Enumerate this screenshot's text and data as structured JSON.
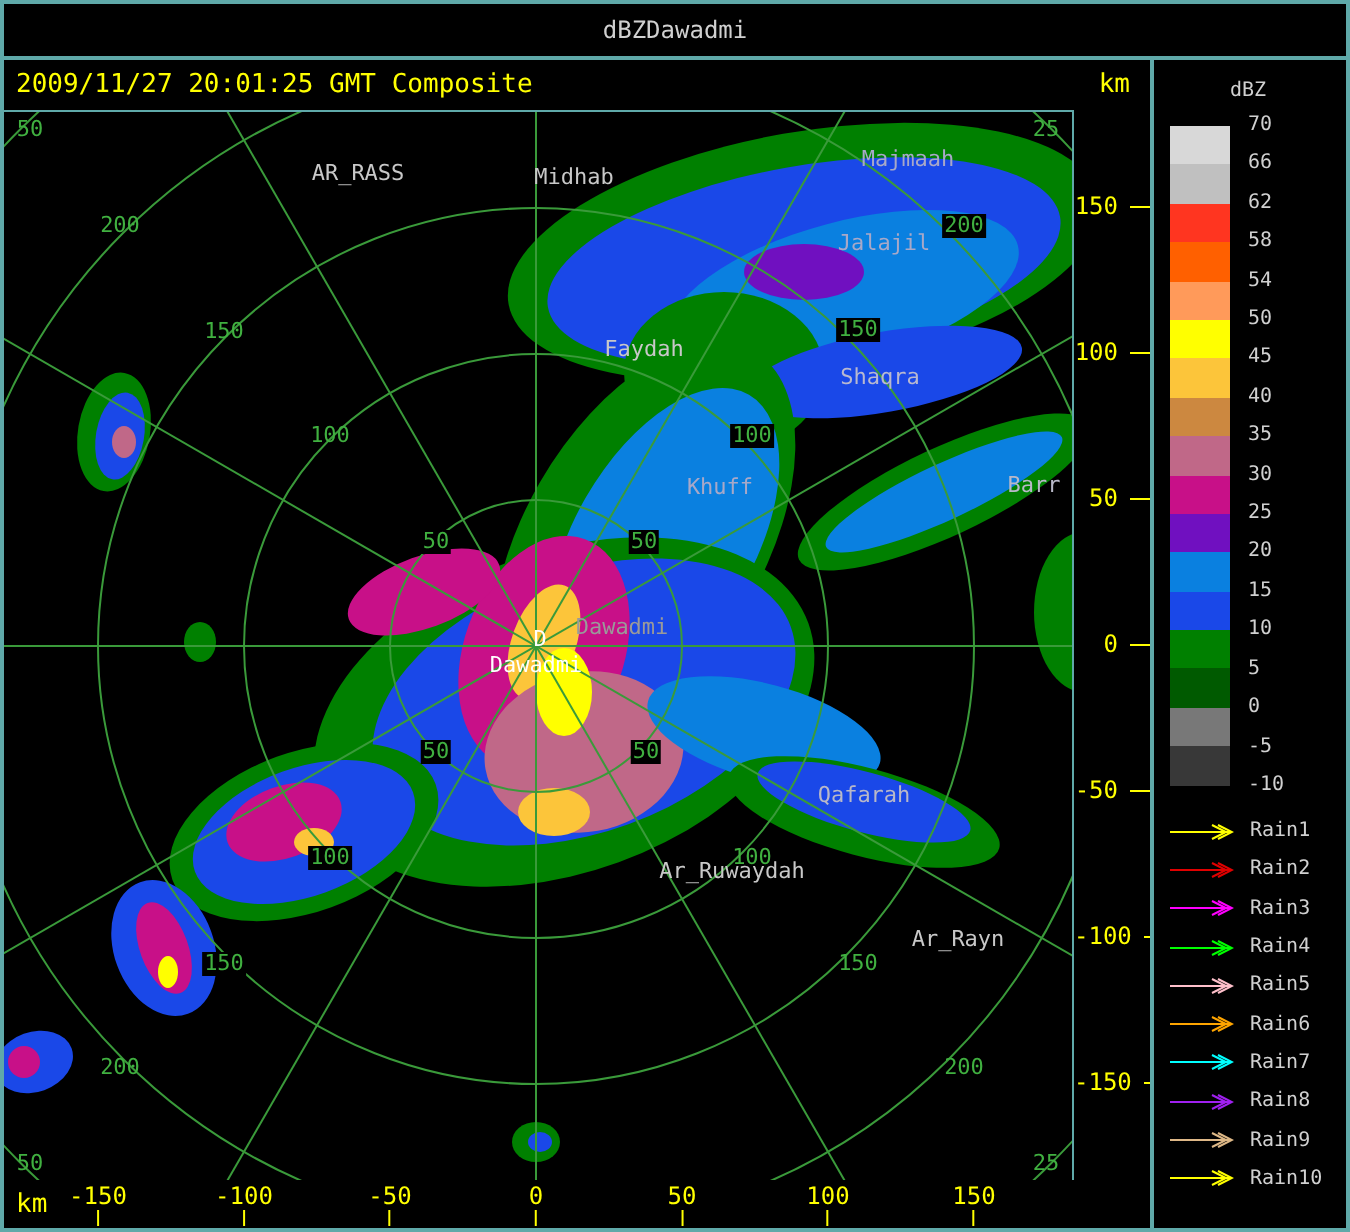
{
  "window": {
    "title": "dBZDawadmi"
  },
  "map": {
    "timestamp": "2009/11/27 20:01:25 GMT Composite",
    "unit": "km",
    "ring_labels": [
      "50",
      "25",
      "200",
      "150",
      "100",
      "50",
      "50",
      "100",
      "150",
      "200",
      "50",
      "100",
      "150",
      "200",
      "50",
      "100",
      "150",
      "200",
      "50",
      "25"
    ],
    "site": {
      "marker": "D",
      "name": "Dawadmi"
    },
    "places": [
      "AR_RASS",
      "Midhab",
      "Majmaah",
      "Jalajil",
      "Faydah",
      "Shaqra",
      "Khuff",
      "Barr",
      "Dawadmi",
      "Qafarah",
      "Ar_Ruwaydah",
      "Ar_Rayn"
    ],
    "y_axis": {
      "ticks": [
        "150",
        "100",
        "50",
        "0",
        "-50",
        "-100",
        "-150"
      ]
    },
    "x_axis": {
      "unit": "km",
      "ticks": [
        "-150",
        "-100",
        "-50",
        "0",
        "50",
        "100",
        "150"
      ]
    }
  },
  "legend": {
    "title": "dBZ",
    "bands": [
      {
        "color": "#d8d8d8"
      },
      {
        "color": "#c0c0c0"
      },
      {
        "color": "#ff3520"
      },
      {
        "color": "#ff6000"
      },
      {
        "color": "#ff9a5a"
      },
      {
        "color": "#ffff00"
      },
      {
        "color": "#fcc53a"
      },
      {
        "color": "#cc8840"
      },
      {
        "color": "#c06888"
      },
      {
        "color": "#c81088"
      },
      {
        "color": "#7010c0"
      },
      {
        "color": "#0a80e0"
      },
      {
        "color": "#1a48e8"
      },
      {
        "color": "#008000"
      },
      {
        "color": "#005a00"
      },
      {
        "color": "#787878"
      },
      {
        "color": "#383838"
      }
    ],
    "levels": [
      "70",
      "66",
      "62",
      "58",
      "54",
      "50",
      "45",
      "40",
      "35",
      "30",
      "25",
      "20",
      "15",
      "10",
      "5",
      "0",
      "-5",
      "-10"
    ],
    "tracks": [
      {
        "label": "Rain1",
        "color": "#ffff00"
      },
      {
        "label": "Rain2",
        "color": "#e00000"
      },
      {
        "label": "Rain3",
        "color": "#ff00ff"
      },
      {
        "label": "Rain4",
        "color": "#00ff00"
      },
      {
        "label": "Rain5",
        "color": "#ffc0cb"
      },
      {
        "label": "Rain6",
        "color": "#ffa500"
      },
      {
        "label": "Rain7",
        "color": "#00ffff"
      },
      {
        "label": "Rain8",
        "color": "#a020f0"
      },
      {
        "label": "Rain9",
        "color": "#deb887"
      },
      {
        "label": "Rain10",
        "color": "#ffff00"
      }
    ]
  }
}
